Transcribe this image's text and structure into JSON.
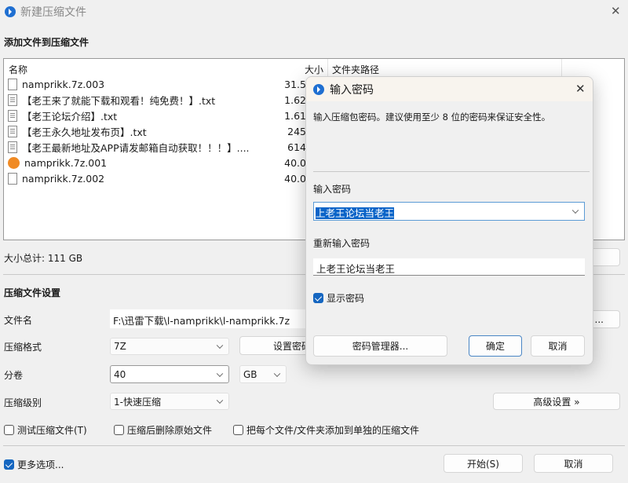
{
  "window": {
    "title": "新建压缩文件",
    "close": "✕"
  },
  "add_section": {
    "title": "添加文件到压缩文件"
  },
  "file_list": {
    "columns": {
      "name": "名称",
      "size": "大小",
      "path": "文件夹路径"
    },
    "rows": [
      {
        "name": "namprikk.7z.003",
        "size": "31.5",
        "icon": "file-icon"
      },
      {
        "name": "【老王来了就能下载和观看！纯免费！】.txt",
        "size": "1.62",
        "icon": "text-file-icon"
      },
      {
        "name": "【老王论坛介绍】.txt",
        "size": "1.61",
        "icon": "text-file-icon"
      },
      {
        "name": "【老王永久地址发布页】.txt",
        "size": "245",
        "icon": "text-file-icon"
      },
      {
        "name": "【老王最新地址及APP请发邮箱自动获取！！！】....",
        "size": "614",
        "icon": "text-file-icon"
      },
      {
        "name": "namprikk.7z.001",
        "size": "40.0",
        "icon": "archive-icon"
      },
      {
        "name": "namprikk.7z.002",
        "size": "40.0",
        "icon": "file-icon"
      }
    ]
  },
  "total": "大小总计: 111 GB",
  "settings": {
    "title": "压缩文件设置",
    "filename_label": "文件名",
    "filename_value": "F:\\迅雷下载\\l-namprikk\\l-namprikk.7z",
    "browse": "...",
    "format_label": "压缩格式",
    "format_value": "7Z",
    "set_password": "设置密码",
    "split_label": "分卷",
    "split_value": "40",
    "split_unit": "GB",
    "level_label": "压缩级别",
    "level_value": "1-快速压缩",
    "advanced": "高级设置 »",
    "test": "测试压缩文件(T)",
    "delete_after": "压缩后删除原始文件",
    "separate": "把每个文件/文件夹添加到单独的压缩文件",
    "more": "更多选项...",
    "start": "开始(S)",
    "cancel": "取消"
  },
  "dialog": {
    "title": "输入密码",
    "close": "✕",
    "description": "输入压缩包密码。建议使用至少 8 位的密码来保证安全性。",
    "password_label": "输入密码",
    "password_value": "上老王论坛当老王",
    "confirm_label": "重新输入密码",
    "confirm_value": "上老王论坛当老王",
    "show_password": "显示密码",
    "manager": "密码管理器...",
    "ok": "确定",
    "cancel": "取消"
  }
}
